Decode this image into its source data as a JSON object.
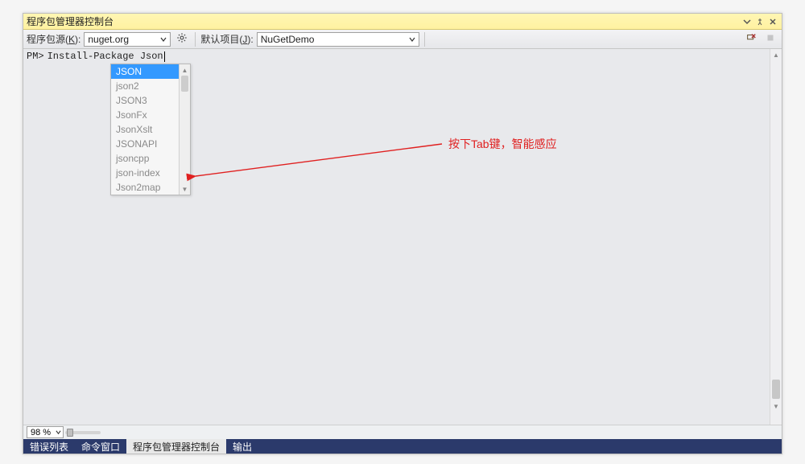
{
  "window": {
    "title": "程序包管理器控制台"
  },
  "toolbar": {
    "source_label_pre": "程序包源(",
    "source_label_key": "K",
    "source_label_post": "):",
    "source_value": "nuget.org",
    "project_label_pre": "默认项目(",
    "project_label_key": "J",
    "project_label_post": "):",
    "project_value": "NuGetDemo"
  },
  "console": {
    "prompt": "PM>",
    "command": "Install-Package Json"
  },
  "autocomplete": {
    "items": [
      {
        "label": "JSON",
        "selected": true
      },
      {
        "label": "json2",
        "selected": false
      },
      {
        "label": "JSON3",
        "selected": false
      },
      {
        "label": "JsonFx",
        "selected": false
      },
      {
        "label": "JsonXslt",
        "selected": false
      },
      {
        "label": "JSONAPI",
        "selected": false
      },
      {
        "label": "jsoncpp",
        "selected": false
      },
      {
        "label": "json-index",
        "selected": false
      },
      {
        "label": "Json2map",
        "selected": false
      }
    ]
  },
  "annotation": {
    "text": "按下Tab键，智能感应"
  },
  "zoom": {
    "value": "98 %"
  },
  "tabs": [
    {
      "label": "错误列表",
      "active": false
    },
    {
      "label": "命令窗口",
      "active": false
    },
    {
      "label": "程序包管理器控制台",
      "active": true
    },
    {
      "label": "输出",
      "active": false
    }
  ]
}
